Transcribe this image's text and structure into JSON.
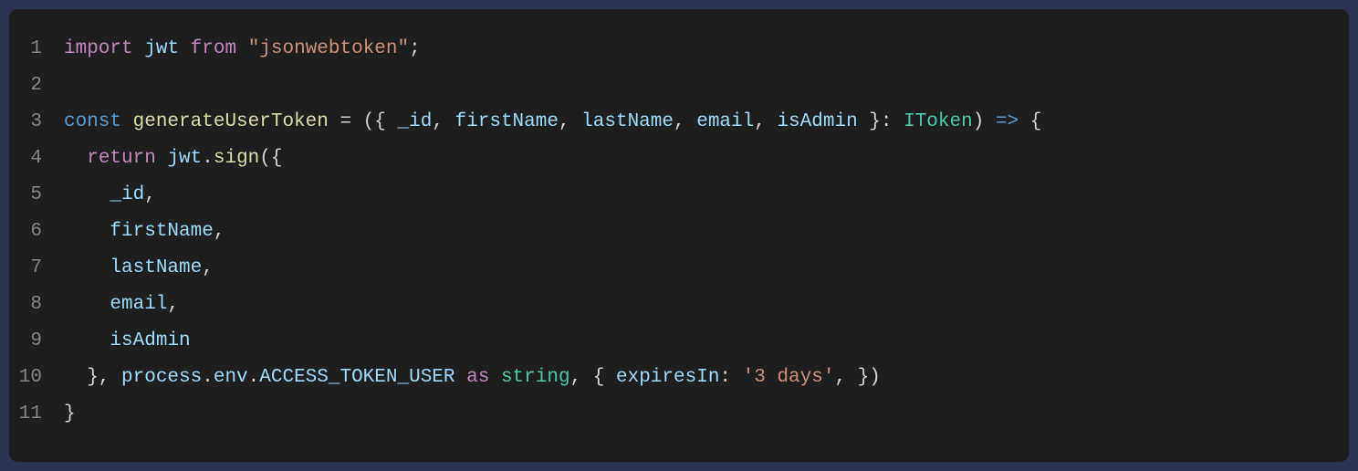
{
  "code": {
    "lines": [
      {
        "num": "1",
        "tokens": [
          {
            "cls": "tok-keyword",
            "t": "import"
          },
          {
            "cls": "tok-punct",
            "t": " "
          },
          {
            "cls": "tok-ident",
            "t": "jwt"
          },
          {
            "cls": "tok-punct",
            "t": " "
          },
          {
            "cls": "tok-keyword",
            "t": "from"
          },
          {
            "cls": "tok-punct",
            "t": " "
          },
          {
            "cls": "tok-string",
            "t": "\"jsonwebtoken\""
          },
          {
            "cls": "tok-punct",
            "t": ";"
          }
        ]
      },
      {
        "num": "2",
        "tokens": []
      },
      {
        "num": "3",
        "tokens": [
          {
            "cls": "tok-const",
            "t": "const"
          },
          {
            "cls": "tok-punct",
            "t": " "
          },
          {
            "cls": "tok-func",
            "t": "generateUserToken"
          },
          {
            "cls": "tok-punct",
            "t": " = ({ "
          },
          {
            "cls": "tok-ident",
            "t": "_id"
          },
          {
            "cls": "tok-punct",
            "t": ", "
          },
          {
            "cls": "tok-ident",
            "t": "firstName"
          },
          {
            "cls": "tok-punct",
            "t": ", "
          },
          {
            "cls": "tok-ident",
            "t": "lastName"
          },
          {
            "cls": "tok-punct",
            "t": ", "
          },
          {
            "cls": "tok-ident",
            "t": "email"
          },
          {
            "cls": "tok-punct",
            "t": ", "
          },
          {
            "cls": "tok-ident",
            "t": "isAdmin"
          },
          {
            "cls": "tok-punct",
            "t": " }: "
          },
          {
            "cls": "tok-type",
            "t": "IToken"
          },
          {
            "cls": "tok-punct",
            "t": ") "
          },
          {
            "cls": "tok-const",
            "t": "=>"
          },
          {
            "cls": "tok-punct",
            "t": " {"
          }
        ]
      },
      {
        "num": "4",
        "tokens": [
          {
            "cls": "tok-punct",
            "t": "  "
          },
          {
            "cls": "tok-keyword",
            "t": "return"
          },
          {
            "cls": "tok-punct",
            "t": " "
          },
          {
            "cls": "tok-ident",
            "t": "jwt"
          },
          {
            "cls": "tok-punct",
            "t": "."
          },
          {
            "cls": "tok-func",
            "t": "sign"
          },
          {
            "cls": "tok-punct",
            "t": "({"
          }
        ]
      },
      {
        "num": "5",
        "tokens": [
          {
            "cls": "tok-punct",
            "t": "    "
          },
          {
            "cls": "tok-ident",
            "t": "_id"
          },
          {
            "cls": "tok-punct",
            "t": ","
          }
        ]
      },
      {
        "num": "6",
        "tokens": [
          {
            "cls": "tok-punct",
            "t": "    "
          },
          {
            "cls": "tok-ident",
            "t": "firstName"
          },
          {
            "cls": "tok-punct",
            "t": ","
          }
        ]
      },
      {
        "num": "7",
        "tokens": [
          {
            "cls": "tok-punct",
            "t": "    "
          },
          {
            "cls": "tok-ident",
            "t": "lastName"
          },
          {
            "cls": "tok-punct",
            "t": ","
          }
        ]
      },
      {
        "num": "8",
        "tokens": [
          {
            "cls": "tok-punct",
            "t": "    "
          },
          {
            "cls": "tok-ident",
            "t": "email"
          },
          {
            "cls": "tok-punct",
            "t": ","
          }
        ]
      },
      {
        "num": "9",
        "tokens": [
          {
            "cls": "tok-punct",
            "t": "    "
          },
          {
            "cls": "tok-ident",
            "t": "isAdmin"
          }
        ]
      },
      {
        "num": "10",
        "tokens": [
          {
            "cls": "tok-punct",
            "t": "  }, "
          },
          {
            "cls": "tok-ident",
            "t": "process"
          },
          {
            "cls": "tok-punct",
            "t": "."
          },
          {
            "cls": "tok-ident",
            "t": "env"
          },
          {
            "cls": "tok-punct",
            "t": "."
          },
          {
            "cls": "tok-prop",
            "t": "ACCESS_TOKEN_USER"
          },
          {
            "cls": "tok-punct",
            "t": " "
          },
          {
            "cls": "tok-keyword",
            "t": "as"
          },
          {
            "cls": "tok-punct",
            "t": " "
          },
          {
            "cls": "tok-type",
            "t": "string"
          },
          {
            "cls": "tok-punct",
            "t": ", { "
          },
          {
            "cls": "tok-ident",
            "t": "expiresIn"
          },
          {
            "cls": "tok-punct",
            "t": ": "
          },
          {
            "cls": "tok-string",
            "t": "'3 days'"
          },
          {
            "cls": "tok-punct",
            "t": ", })"
          }
        ]
      },
      {
        "num": "11",
        "tokens": [
          {
            "cls": "tok-punct",
            "t": "}"
          }
        ]
      }
    ]
  }
}
